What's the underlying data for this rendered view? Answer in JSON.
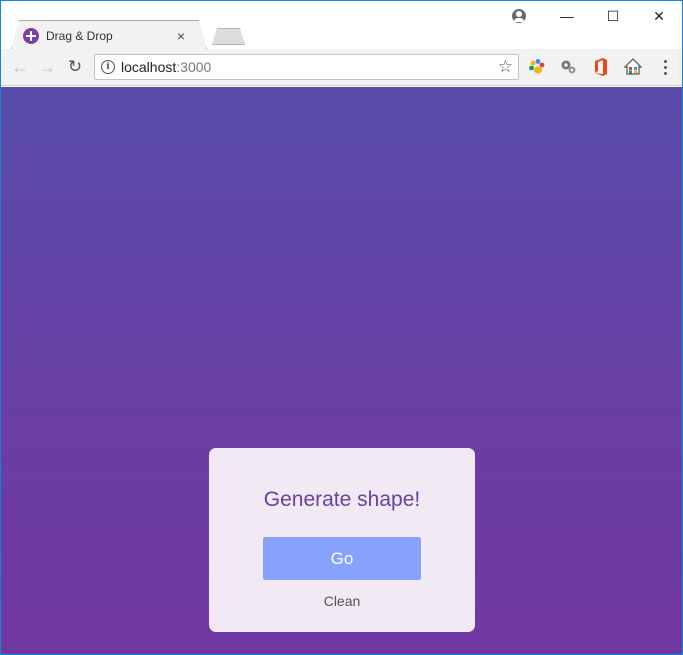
{
  "browser": {
    "tab_title": "Drag & Drop",
    "tab_close": "×",
    "url_host": "localhost",
    "url_port": ":3000",
    "info_glyph": "i",
    "window_controls": {
      "minimize": "—",
      "maximize": "☐",
      "close": "✕"
    },
    "nav": {
      "back": "←",
      "forward": "→",
      "reload": "↻"
    },
    "bookmark_star": "☆",
    "extensions": [
      "paw-extension-icon",
      "gear-extension-icon",
      "office-extension-icon",
      "home-extension-icon"
    ]
  },
  "card": {
    "title": "Generate shape!",
    "go_label": "Go",
    "clean_label": "Clean"
  },
  "colors": {
    "accent": "#6a3fa0",
    "button": "#87a2fd",
    "card_bg": "#f1eaf5",
    "page_gradient_top": "#584ba9",
    "page_gradient_bottom": "#7138a2"
  }
}
